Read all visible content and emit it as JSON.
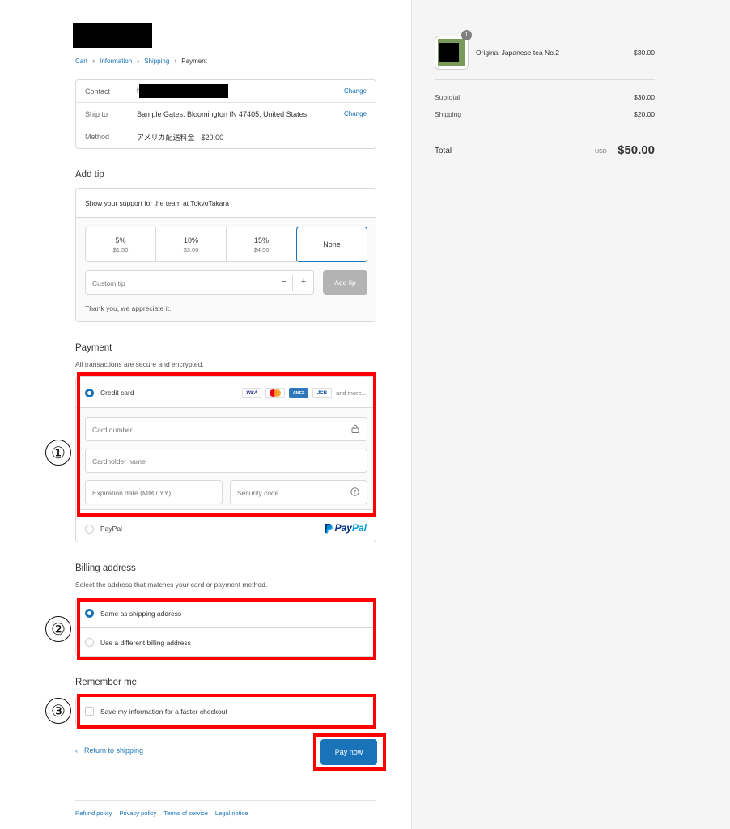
{
  "breadcrumb": [
    "Cart",
    "Information",
    "Shipping",
    "Payment"
  ],
  "summary": {
    "contact_label": "Contact",
    "contact_value": "h",
    "change": "Change",
    "ship_label": "Ship to",
    "ship_value": "Sample Gates, Bloomington IN 47405, United States",
    "method_label": "Method",
    "method_value": "アメリカ配送料金 · $20.00"
  },
  "tip": {
    "title": "Add tip",
    "support_text": "Show your support for the team at TokyoTakara",
    "options": [
      {
        "pct": "5%",
        "amount": "$1.50"
      },
      {
        "pct": "10%",
        "amount": "$3.00"
      },
      {
        "pct": "15%",
        "amount": "$4.50"
      },
      {
        "pct": "None",
        "amount": ""
      }
    ],
    "selected": "None",
    "custom_placeholder": "Custom tip",
    "minus": "−",
    "plus": "+",
    "add_button": "Add tip",
    "thanks": "Thank you, we appreciate it."
  },
  "payment": {
    "title": "Payment",
    "subtitle": "All transactions are secure and encrypted.",
    "credit_card_label": "Credit card",
    "cards": [
      "VISA",
      "MasterCard",
      "AMEX",
      "JCB"
    ],
    "and_more": "and more...",
    "card_number_placeholder": "Card number",
    "cardholder_placeholder": "Cardholder name",
    "expiration_placeholder": "Expiration date (MM / YY)",
    "security_placeholder": "Security code",
    "paypal_label": "PayPal",
    "paypal_logo_1": "Pay",
    "paypal_logo_2": "Pal"
  },
  "billing": {
    "title": "Billing address",
    "subtitle": "Select the address that matches your card or payment method.",
    "same_label": "Same as shipping address",
    "different_label": "Use a different billing address"
  },
  "remember": {
    "title": "Remember me",
    "save_label": "Save my information for a faster checkout"
  },
  "actions": {
    "return_label": "Return to shipping",
    "pay_label": "Pay now"
  },
  "annotations": [
    "①",
    "②",
    "③"
  ],
  "footer": [
    "Refund policy",
    "Privacy policy",
    "Terms of service",
    "Legal notice"
  ],
  "order": {
    "product_name": "Original Japanese tea No.2",
    "product_price": "$30.00",
    "quantity": "1",
    "subtotal_label": "Subtotal",
    "subtotal_value": "$30.00",
    "shipping_label": "Shipping",
    "shipping_value": "$20.00",
    "total_label": "Total",
    "currency": "USD",
    "total_value": "$50.00"
  },
  "colors": {
    "accent": "#1a73b8",
    "highlight": "#ff0000",
    "sidebar_bg": "#f5f5f5"
  }
}
